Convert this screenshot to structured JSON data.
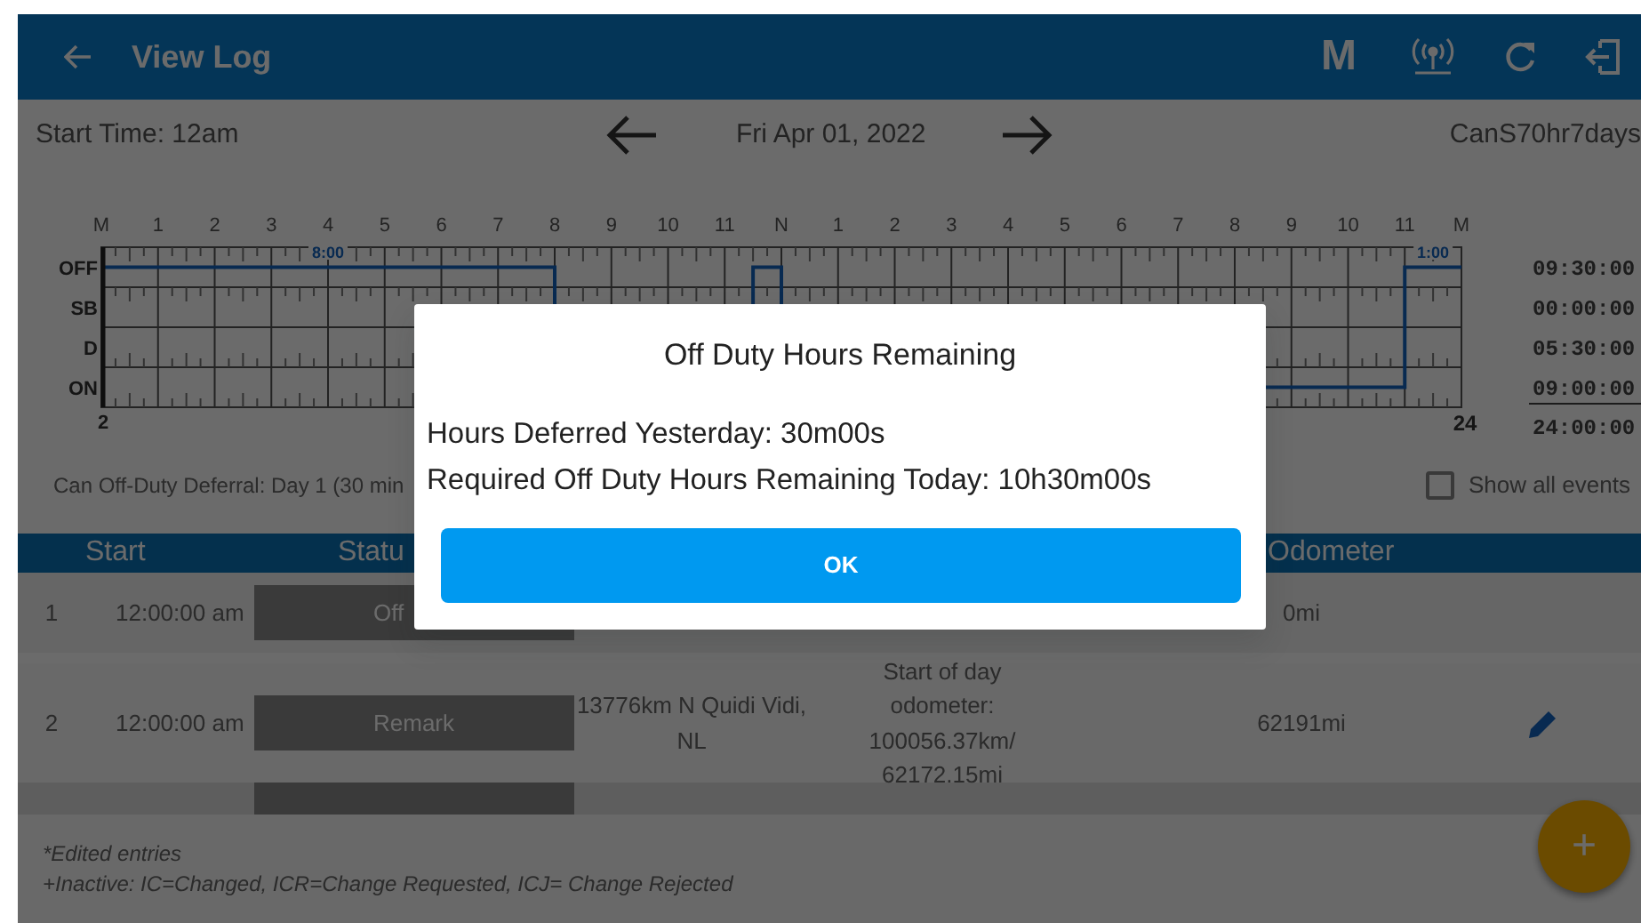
{
  "app_bar": {
    "title": "View Log",
    "mode_letter": "M"
  },
  "date_nav": {
    "start_time": "Start Time: 12am",
    "date": "Fri Apr 01, 2022",
    "ruleset": "CanS70hr7days"
  },
  "graph": {
    "hour_labels": [
      "M",
      "1",
      "2",
      "3",
      "4",
      "5",
      "6",
      "7",
      "8",
      "9",
      "10",
      "11",
      "N",
      "1",
      "2",
      "3",
      "4",
      "5",
      "6",
      "7",
      "8",
      "9",
      "10",
      "11",
      "M"
    ],
    "duty_rows": [
      {
        "label": "OFF",
        "total": "09:30:00"
      },
      {
        "label": "SB",
        "total": "00:00:00"
      },
      {
        "label": "D",
        "total": "05:30:00"
      },
      {
        "label": "ON",
        "total": "09:00:00"
      }
    ],
    "segment_labels": [
      "8:00",
      "1:00"
    ],
    "start_marker": "2",
    "end_marker": "24",
    "grand_total": "24:00:00"
  },
  "deferral_note": "Can Off-Duty Deferral: Day 1 (30 min",
  "show_all_events": {
    "label": "Show all events",
    "checked": false
  },
  "table": {
    "columns": [
      "Start",
      "Statu",
      "Odometer"
    ],
    "rows": [
      {
        "kind": "entry",
        "index": "1",
        "start": "12:00:00 am",
        "status": "Off",
        "odometer": "0mi",
        "editable": false
      },
      {
        "kind": "entry",
        "index": "2",
        "start": "12:00:00 am",
        "status": "Remark",
        "location": "13776km N Quidi Vidi, NL",
        "notes": "Start of day odometer: 100056.37km/ 62172.15mi",
        "odometer": "62191mi",
        "editable": true
      },
      {
        "kind": "clipped"
      }
    ]
  },
  "footer": [
    "*Edited entries",
    "+Inactive: IC=Changed, ICR=Change Requested, ICJ= Change Rejected"
  ],
  "fab": "+",
  "dialog": {
    "title": "Off Duty Hours Remaining",
    "lines": [
      "Hours Deferred Yesterday: 30m00s",
      "Required Off Duty Hours Remaining Today: 10h30m00s"
    ],
    "button": "OK"
  }
}
